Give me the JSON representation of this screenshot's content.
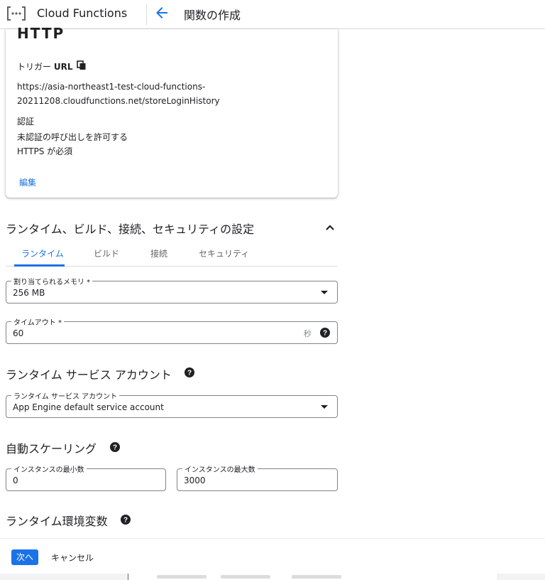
{
  "appbar": {
    "product_name": "Cloud Functions",
    "page_title": "関数の作成"
  },
  "trigger_card": {
    "cut_heading": "HTTP",
    "trigger_label_prefix": "トリガー",
    "trigger_label_bold": "URL",
    "url_line1": "https://asia-northeast1-test-cloud-functions-",
    "url_line2": "20211208.cloudfunctions.net/storeLoginHistory",
    "auth_heading": "認証",
    "auth_line1": "未認証の呼び出しを許可する",
    "auth_line2": "HTTPS が必須",
    "edit_label": "編集"
  },
  "runtime_section": {
    "title": "ランタイム、ビルド、接続、セキュリティの設定",
    "tabs": [
      {
        "label": "ランタイム",
        "active": true
      },
      {
        "label": "ビルド",
        "active": false
      },
      {
        "label": "接続",
        "active": false
      },
      {
        "label": "セキュリティ",
        "active": false
      }
    ]
  },
  "memory_field": {
    "label": "割り当てられるメモリ *",
    "value": "256 MB"
  },
  "timeout_field": {
    "label": "タイムアウト *",
    "value": "60",
    "suffix": "秒"
  },
  "service_account_section": {
    "title": "ランタイム サービス アカウント",
    "field_label": "ランタイム サービス アカウント",
    "field_value": "App Engine default service account"
  },
  "autoscaling_section": {
    "title": "自動スケーリング",
    "min_label": "インスタンスの最小数",
    "min_value": "0",
    "max_label": "インスタンスの最大数",
    "max_value": "3000"
  },
  "env_section": {
    "title": "ランタイム環境変数"
  },
  "bottom_bar": {
    "next_label": "次へ",
    "cancel_label": "キャンセル"
  },
  "colors": {
    "accent": "#1a73e8",
    "text": "#202124",
    "secondary_text": "#5f6368",
    "border": "#dadce0"
  }
}
